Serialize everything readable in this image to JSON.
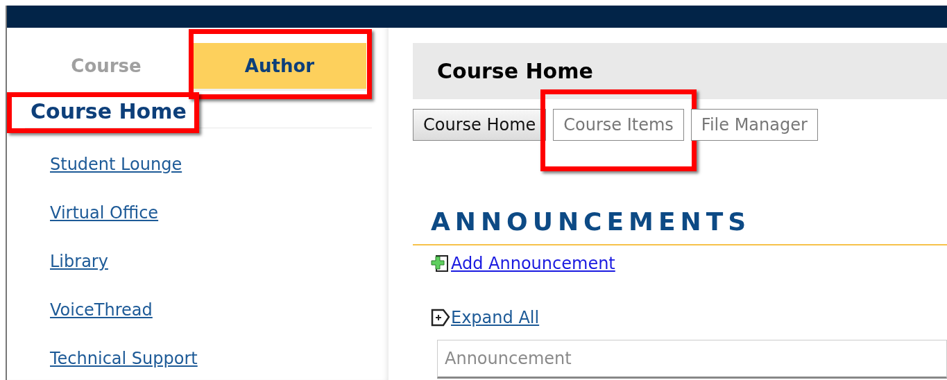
{
  "sidebar": {
    "tabs": [
      {
        "label": "Course",
        "selected": false,
        "highlighted": false
      },
      {
        "label": "Author",
        "selected": true,
        "highlighted": true
      }
    ],
    "heading": {
      "text": "Course Home",
      "highlighted": true
    },
    "links": [
      "Student Lounge",
      "Virtual Office",
      "Library",
      "VoiceThread",
      "Technical Support"
    ]
  },
  "main": {
    "title": "Course Home",
    "subtabs": [
      {
        "label": "Course Home",
        "selected": true,
        "highlighted": false
      },
      {
        "label": "Course Items",
        "selected": false,
        "highlighted": true
      },
      {
        "label": "File Manager",
        "selected": false,
        "highlighted": false
      }
    ],
    "section_title": "ANNOUNCEMENTS",
    "actions": [
      {
        "kind": "add",
        "label": "Add Announcement"
      },
      {
        "kind": "expand",
        "label": "Expand All"
      }
    ],
    "table": {
      "columns": [
        "Announcement"
      ]
    }
  }
}
